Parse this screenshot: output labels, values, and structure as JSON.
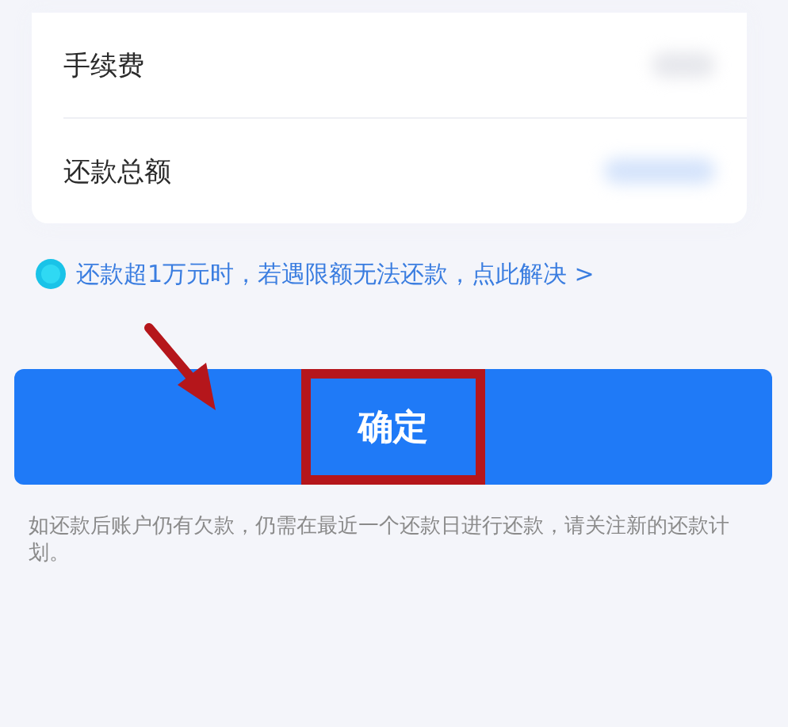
{
  "rows": [
    {
      "label": "手续费",
      "value_hidden": true,
      "color": "#e6e7ec"
    },
    {
      "label": "还款总额",
      "value_hidden": true,
      "color": "#d4e3fb"
    }
  ],
  "notice": {
    "text": "还款超1万元时，若遇限额无法还款，点此解决 >"
  },
  "button": {
    "label": "确定",
    "highlighted": true
  },
  "note": {
    "text": "如还款后账户仍有欠款，仍需在最近一个还款日进行还款，请关注新的还款计划。"
  }
}
